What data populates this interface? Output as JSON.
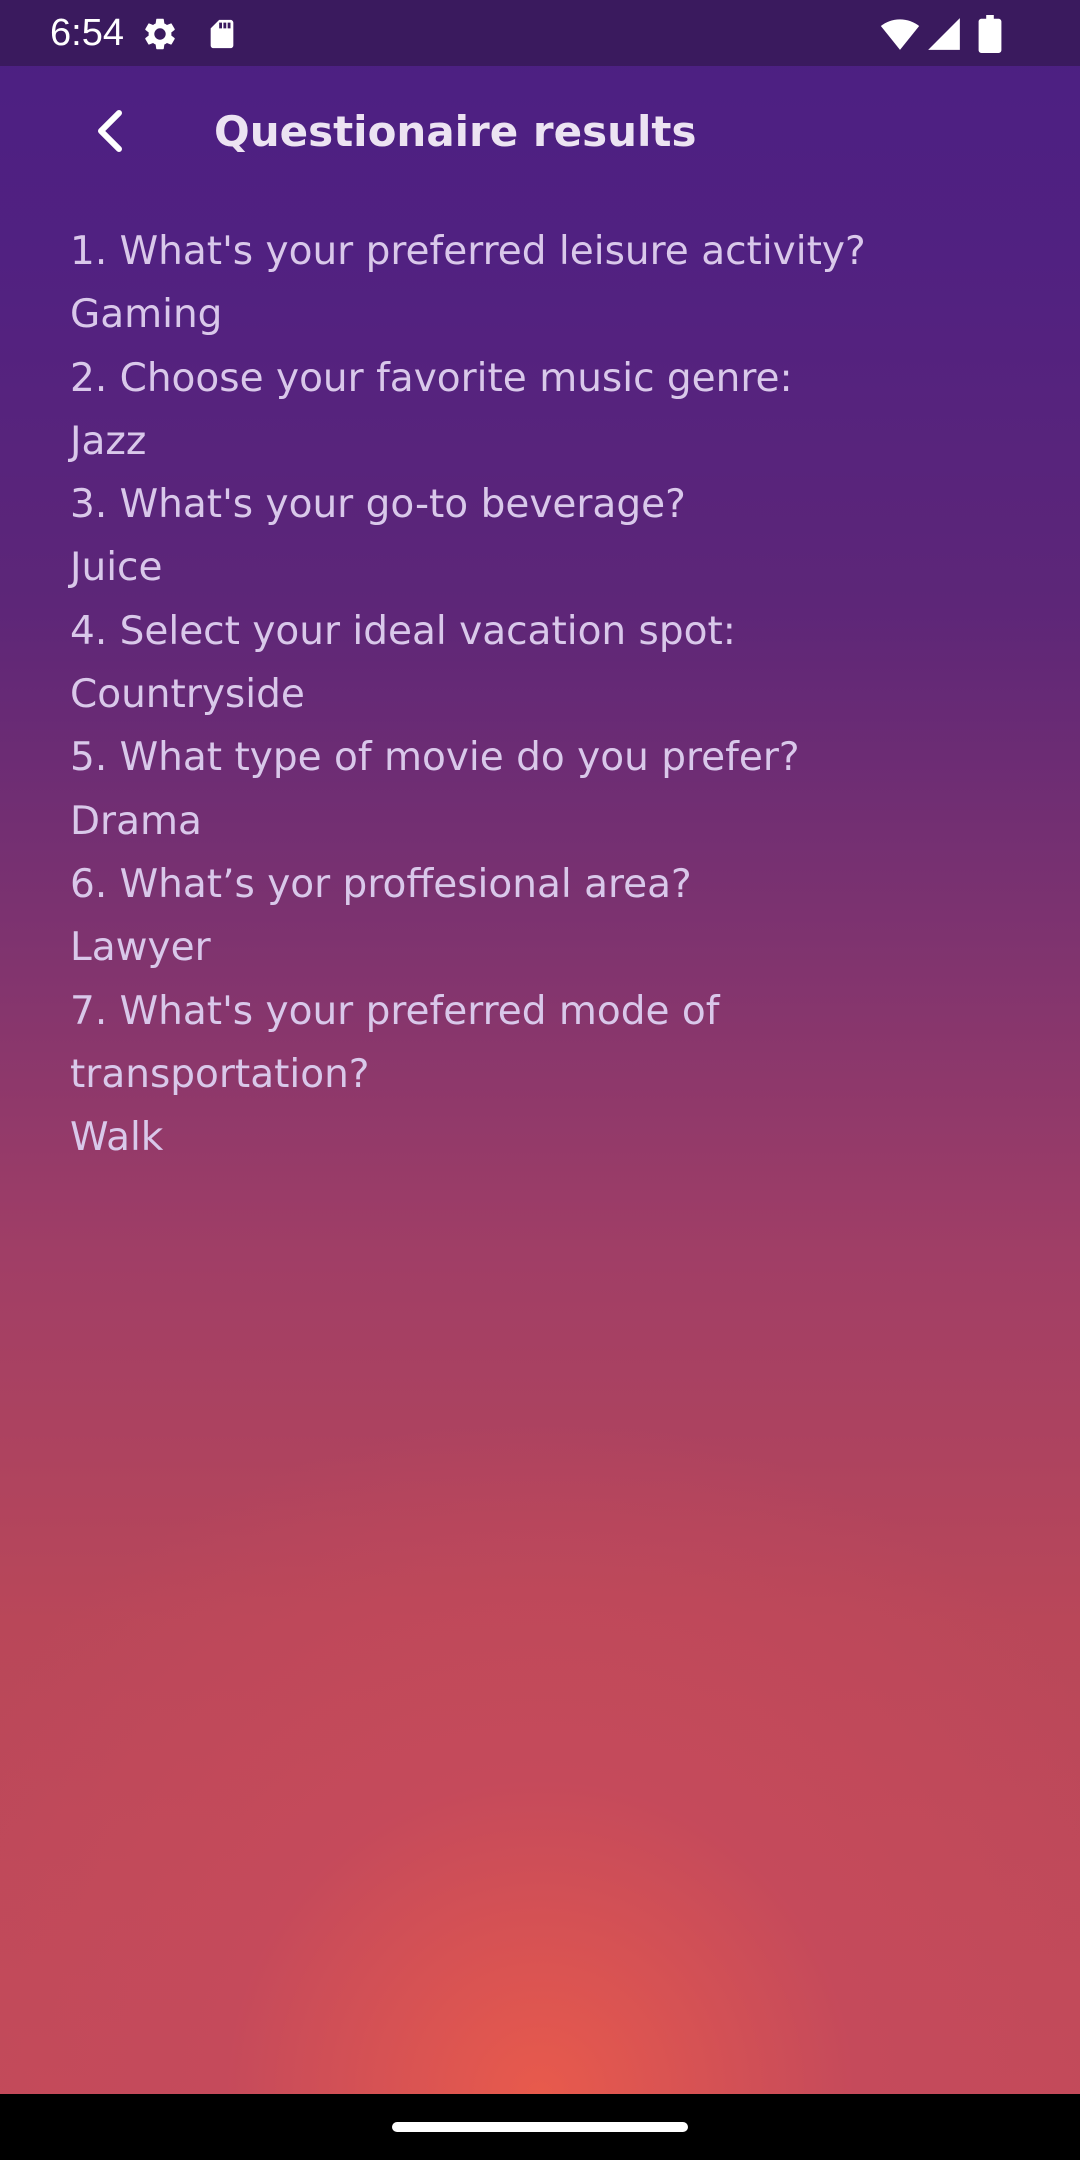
{
  "status_bar": {
    "time": "6:54",
    "icons": [
      "settings-icon",
      "sd-card-icon",
      "wifi-icon",
      "cellular-signal-icon",
      "battery-icon"
    ]
  },
  "app_bar": {
    "title": "Questionaire results",
    "back_icon": "chevron-left-icon"
  },
  "results": [
    {
      "question": "1. What's your preferred leisure activity?",
      "answer": "Gaming"
    },
    {
      "question": "2. Choose your favorite music genre:",
      "answer": "Jazz"
    },
    {
      "question": "3. What's your go-to beverage?",
      "answer": "Juice"
    },
    {
      "question": "4. Select your ideal vacation spot:",
      "answer": "Countryside"
    },
    {
      "question": "5. What type of movie do you prefer?",
      "answer": "Drama"
    },
    {
      "question": "6. What’s yor proffesional area?",
      "answer": "Lawyer"
    },
    {
      "question_line_1": "7. What's your preferred mode of",
      "question_line_2": "transportation?",
      "answer": "Walk"
    }
  ],
  "colors": {
    "status_bar": "#3a1a5e",
    "gradient_top": "#4b1f82",
    "gradient_bottom": "#e85a4c",
    "text": "#d9c8ea",
    "title": "#ece3f2",
    "nav_bar": "#000000"
  }
}
